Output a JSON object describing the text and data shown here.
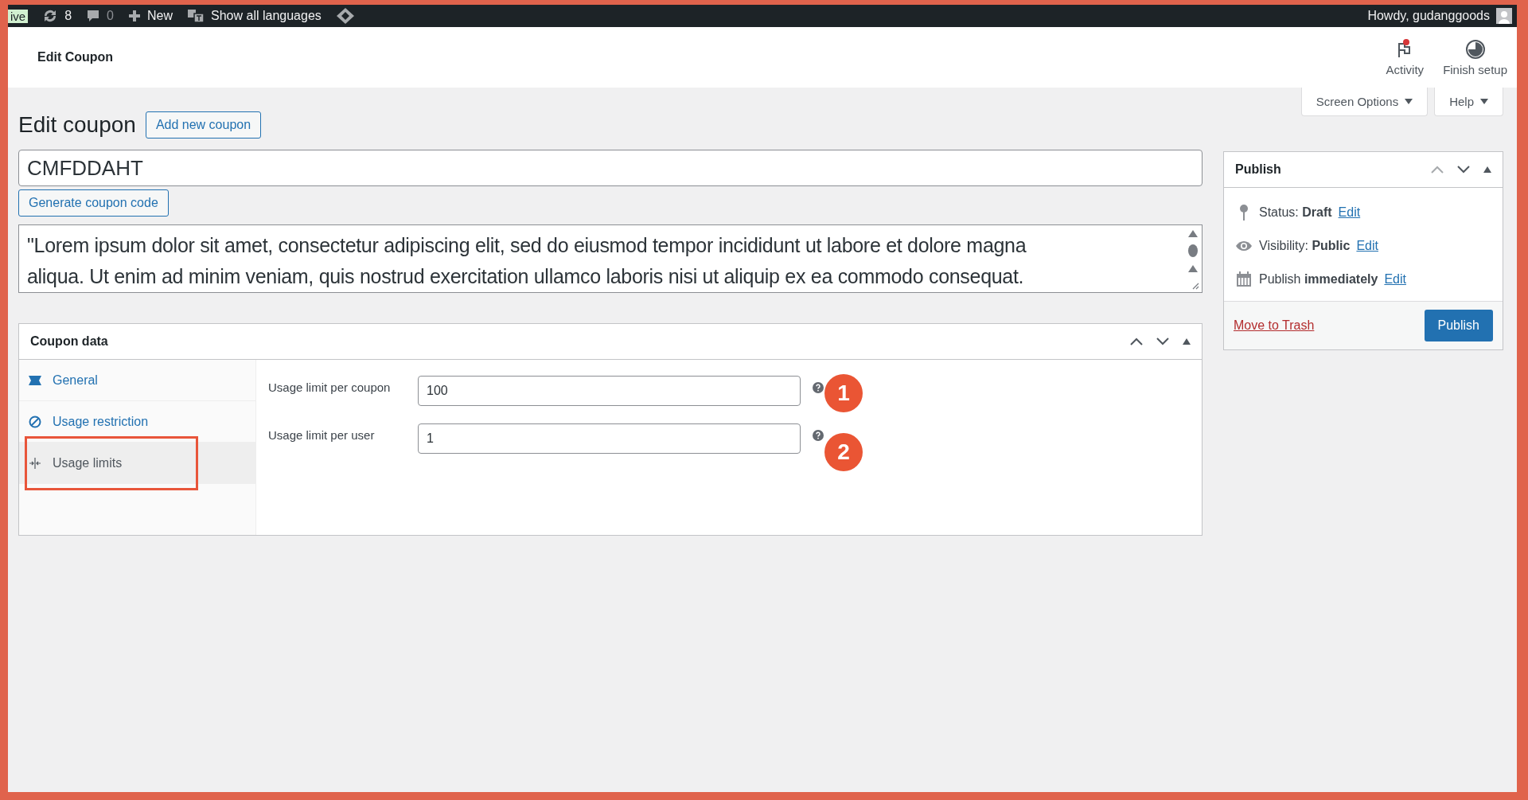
{
  "admin_bar": {
    "site_badge": "ive",
    "updates": "8",
    "comments": "0",
    "new_label": "New",
    "languages_label": "Show all languages",
    "greeting": "Howdy, gudanggoods"
  },
  "header": {
    "title": "Edit Coupon",
    "actions": [
      {
        "kind": "activity",
        "label": "Activity",
        "alert": true
      },
      {
        "kind": "setup",
        "label": "Finish setup",
        "alert": false
      }
    ]
  },
  "screen_tabs": [
    "Screen Options",
    "Help"
  ],
  "page": {
    "title": "Edit coupon",
    "add_new": "Add new coupon"
  },
  "coupon_code": {
    "value": "CMFDDAHT"
  },
  "generate_button": "Generate coupon code",
  "description": {
    "lines": [
      "\"Lorem ipsum dolor sit amet, consectetur adipiscing elit, sed do eiusmod tempor incididunt ut labore et dolore magna",
      "aliqua. Ut enim ad minim veniam, quis nostrud exercitation ullamco laboris nisi ut aliquip ex ea commodo consequat."
    ]
  },
  "coupon_data": {
    "title": "Coupon data",
    "tabs": [
      {
        "kind": "general",
        "label": "General",
        "selected": false,
        "highlighted": false
      },
      {
        "kind": "restriction",
        "label": "Usage restriction",
        "selected": false,
        "highlighted": false
      },
      {
        "kind": "limits",
        "label": "Usage limits",
        "selected": true,
        "highlighted": true
      }
    ],
    "fields": [
      {
        "label": "Usage limit per coupon",
        "value": "100",
        "callout": "1"
      },
      {
        "label": "Usage limit per user",
        "value": "1",
        "callout": "2"
      }
    ]
  },
  "publish": {
    "title": "Publish",
    "rows": [
      {
        "kind": "status",
        "label": "Status:",
        "value": "Draft",
        "link": "Edit"
      },
      {
        "kind": "visibility",
        "label": "Visibility:",
        "value": "Public",
        "link": "Edit"
      },
      {
        "kind": "schedule",
        "label": "Publish",
        "value": "immediately",
        "link": "Edit"
      }
    ],
    "trash": "Move to Trash",
    "button": "Publish"
  }
}
